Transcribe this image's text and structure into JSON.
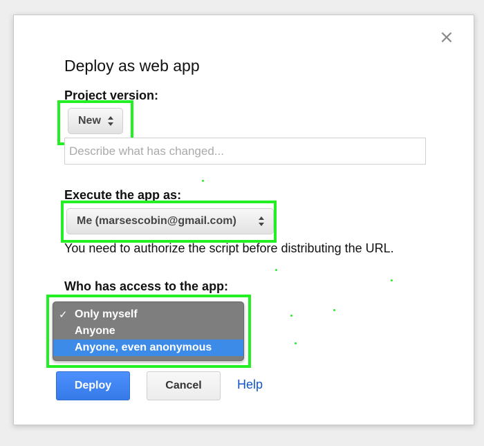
{
  "dialog": {
    "title": "Deploy as web app",
    "close_label": "×"
  },
  "project_version": {
    "label": "Project version:",
    "selected": "New",
    "description_placeholder": "Describe what has changed..."
  },
  "execute_as": {
    "label": "Execute the app as:",
    "selected": "Me (marsescobin@gmail.com)",
    "note": "You need to authorize the script before distributing the URL."
  },
  "access": {
    "label": "Who has access to the app:",
    "check_mark": "✓",
    "options": [
      {
        "label": "Only myself",
        "checked": true,
        "highlighted": false
      },
      {
        "label": "Anyone",
        "checked": false,
        "highlighted": false
      },
      {
        "label": "Anyone, even anonymous",
        "checked": false,
        "highlighted": true
      }
    ]
  },
  "buttons": {
    "deploy": "Deploy",
    "cancel": "Cancel",
    "help": "Help"
  },
  "colors": {
    "highlight_box": "#22f022",
    "primary_button": "#4d90fe",
    "menu_selection": "#3c8be8",
    "link": "#1155cc"
  }
}
